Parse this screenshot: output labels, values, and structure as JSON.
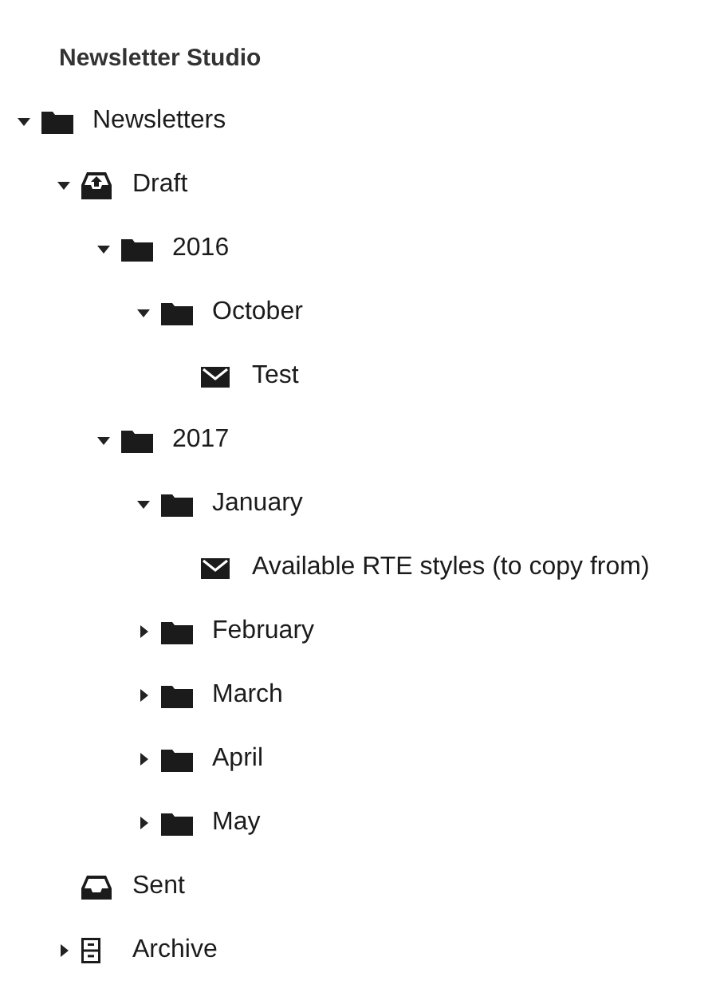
{
  "title": "Newsletter Studio",
  "tree": [
    {
      "label": "Newsletters",
      "kind": "folder",
      "expanded": true,
      "children": [
        {
          "label": "Draft",
          "kind": "outbox",
          "expanded": true,
          "children": [
            {
              "label": "2016",
              "kind": "folder",
              "expanded": true,
              "children": [
                {
                  "label": "October",
                  "kind": "folder",
                  "expanded": true,
                  "children": [
                    {
                      "label": "Test",
                      "kind": "mail"
                    }
                  ]
                }
              ]
            },
            {
              "label": "2017",
              "kind": "folder",
              "expanded": true,
              "children": [
                {
                  "label": "January",
                  "kind": "folder",
                  "expanded": true,
                  "children": [
                    {
                      "label": "Available RTE styles (to copy from)",
                      "kind": "mail"
                    }
                  ]
                },
                {
                  "label": "February",
                  "kind": "folder",
                  "expanded": false
                },
                {
                  "label": "March",
                  "kind": "folder",
                  "expanded": false
                },
                {
                  "label": "April",
                  "kind": "folder",
                  "expanded": false
                },
                {
                  "label": "May",
                  "kind": "folder",
                  "expanded": false
                }
              ]
            }
          ]
        },
        {
          "label": "Sent",
          "kind": "inbox"
        },
        {
          "label": "Archive",
          "kind": "archive",
          "expanded": false
        }
      ]
    }
  ]
}
